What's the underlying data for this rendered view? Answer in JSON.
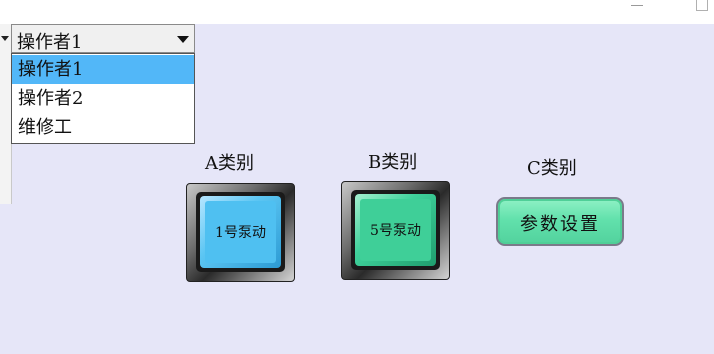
{
  "operator_select": {
    "selected": "操作者1",
    "options": [
      "操作者1",
      "操作者2",
      "维修工"
    ],
    "highlighted_index": 0
  },
  "categories": {
    "a_label": "A类别",
    "b_label": "B类别",
    "c_label": "C类别"
  },
  "pumps": {
    "pump1_label": "1号泵动",
    "pump5_label": "5号泵动"
  },
  "param_button": {
    "label": "参数设置"
  },
  "colors": {
    "background": "#e6e6f8",
    "selection": "#52b7f8",
    "pump_a": "#4fc0f1",
    "pump_b": "#3fcf98",
    "param_button": "#62e1ac"
  },
  "icons": {
    "combo_arrow": "chevron-down-icon",
    "window_minimize": "minimize-icon",
    "window_maximize": "maximize-icon"
  }
}
